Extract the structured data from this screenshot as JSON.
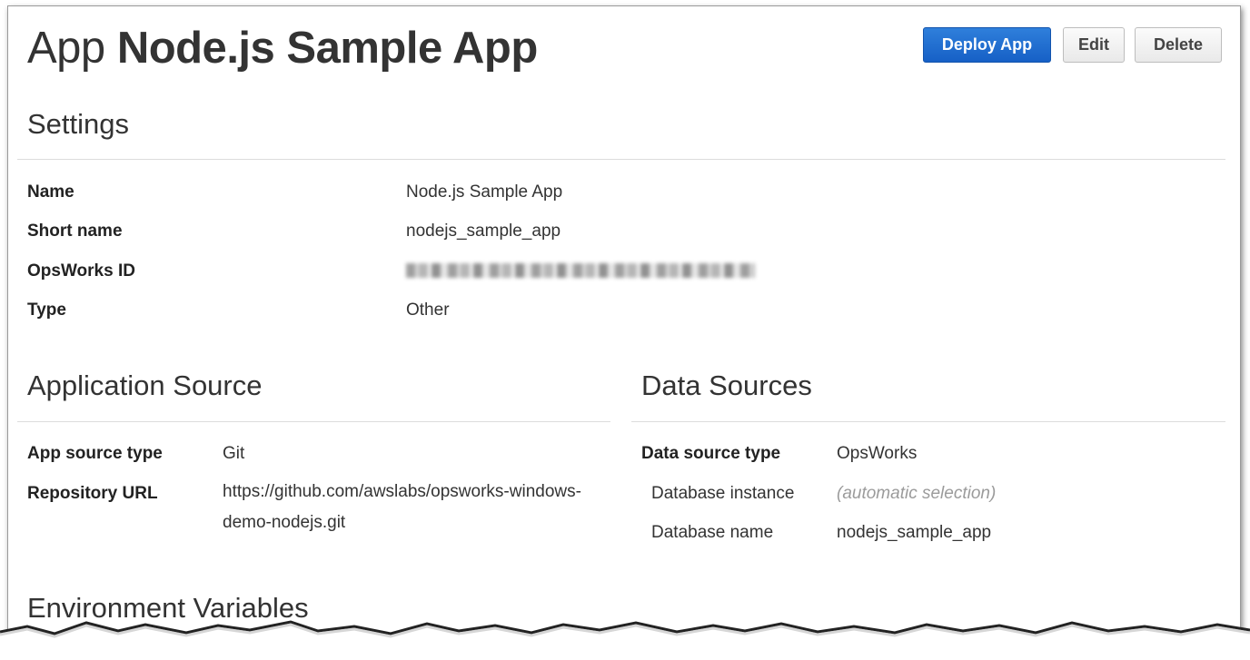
{
  "header": {
    "title_prefix": "App",
    "title_name": "Node.js Sample App",
    "buttons": {
      "deploy": "Deploy App",
      "edit": "Edit",
      "delete": "Delete"
    },
    "colors": {
      "primary": "#1a67cf"
    }
  },
  "settings": {
    "heading": "Settings",
    "rows": [
      {
        "label": "Name",
        "value": "Node.js Sample App"
      },
      {
        "label": "Short name",
        "value": "nodejs_sample_app"
      },
      {
        "label": "OpsWorks ID",
        "value": ""
      },
      {
        "label": "Type",
        "value": "Other"
      }
    ]
  },
  "app_source": {
    "heading": "Application Source",
    "rows": [
      {
        "label": "App source type",
        "value": "Git"
      },
      {
        "label": "Repository URL",
        "value": "https://github.com/awslabs/opsworks-windows-demo-nodejs.git"
      }
    ]
  },
  "data_sources": {
    "heading": "Data Sources",
    "type_label": "Data source type",
    "type_value": "OpsWorks",
    "sub_rows": [
      {
        "label": "Database instance",
        "value": "(automatic selection)"
      },
      {
        "label": "Database name",
        "value": "nodejs_sample_app"
      }
    ]
  },
  "env": {
    "heading": "Environment Variables"
  }
}
